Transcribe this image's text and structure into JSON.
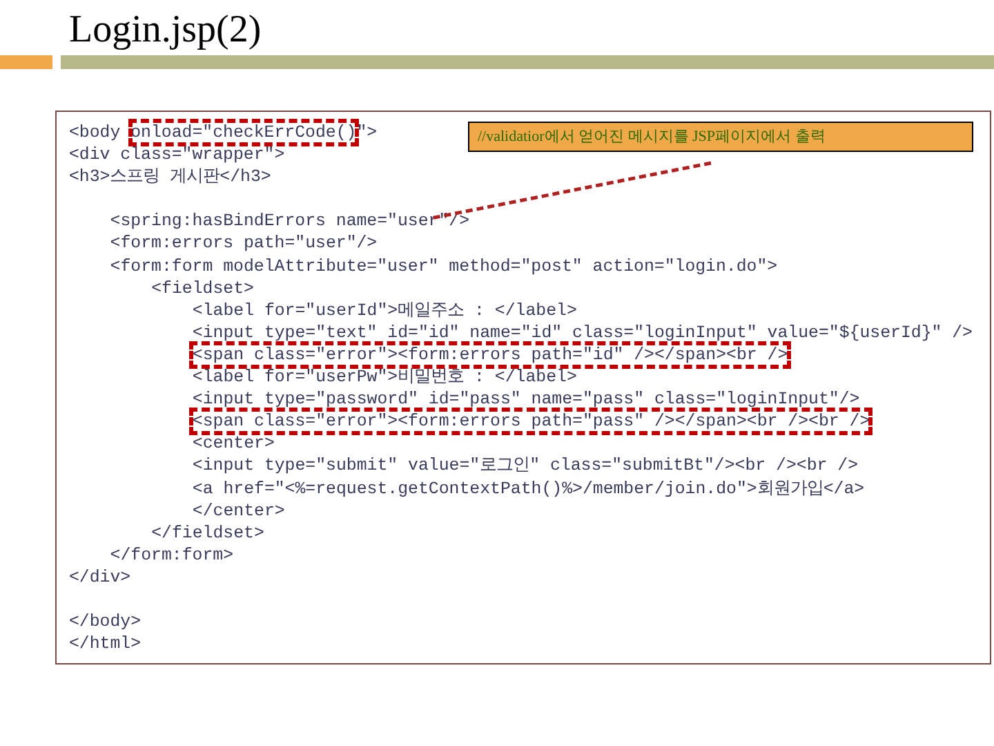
{
  "slide": {
    "title": "Login.jsp(2)"
  },
  "code": {
    "lines": [
      {
        "kind": "code",
        "segments": [
          {
            "text": "<body ",
            "highlighted": false
          },
          {
            "text": "onload=\"checkErrCode()",
            "highlighted": true
          },
          {
            "text": "\">",
            "highlighted": false
          }
        ]
      },
      {
        "kind": "code",
        "segments": [
          {
            "text": "<div class=\"wrapper\">",
            "highlighted": false
          }
        ]
      },
      {
        "kind": "code",
        "segments": [
          {
            "text": "<h3>스프링 게시판</h3>",
            "highlighted": false
          }
        ]
      },
      {
        "kind": "blank"
      },
      {
        "kind": "group",
        "children": [
          {
            "kind": "code",
            "segments": [
              {
                "text": "<spring:hasBindErrors name=\"user\"/>",
                "highlighted": false
              }
            ]
          },
          {
            "kind": "code",
            "segments": [
              {
                "text": "<form:errors path=\"user\"/>",
                "highlighted": false
              }
            ]
          },
          {
            "kind": "code",
            "segments": [
              {
                "text": "<form:form modelAttribute=\"user\" method=\"post\" action=\"login.do\">",
                "highlighted": false
              }
            ]
          },
          {
            "kind": "group",
            "children": [
              {
                "kind": "code",
                "segments": [
                  {
                    "text": "<fieldset>",
                    "highlighted": false
                  }
                ]
              },
              {
                "kind": "group",
                "children": [
                  {
                    "kind": "code",
                    "segments": [
                      {
                        "text": "<label for=\"userId\">메일주소 : </label>",
                        "highlighted": false
                      }
                    ]
                  },
                  {
                    "kind": "code",
                    "segments": [
                      {
                        "text": "<input type=\"text\" id=\"id\" name=\"id\" class=\"loginInput\" value=\"${userId}\" />",
                        "highlighted": false
                      }
                    ]
                  },
                  {
                    "kind": "code",
                    "segments": [
                      {
                        "text": "<span class=\"error\"><form:errors path=\"id\" /></span><br />",
                        "highlighted": true
                      }
                    ]
                  },
                  {
                    "kind": "code",
                    "segments": [
                      {
                        "text": "<label for=\"userPw\">비밀번호 : </label>",
                        "highlighted": false
                      }
                    ]
                  },
                  {
                    "kind": "code",
                    "segments": [
                      {
                        "text": "<input type=\"password\" id=\"pass\" name=\"pass\" class=\"loginInput\"/>",
                        "highlighted": false
                      }
                    ]
                  },
                  {
                    "kind": "code",
                    "segments": [
                      {
                        "text": "<span class=\"error\"><form:errors path=\"pass\" /></span><br /><br />",
                        "highlighted": true
                      }
                    ]
                  },
                  {
                    "kind": "code",
                    "segments": [
                      {
                        "text": "<center>",
                        "highlighted": false
                      }
                    ]
                  },
                  {
                    "kind": "code",
                    "segments": [
                      {
                        "text": "<input type=\"submit\" value=\"로그인\" class=\"submitBt\"/><br /><br />",
                        "highlighted": false
                      }
                    ]
                  },
                  {
                    "kind": "code",
                    "segments": [
                      {
                        "text": "<a href=\"<%=request.getContextPath()%>/member/join.do\">회원가입</a>",
                        "highlighted": false
                      }
                    ]
                  },
                  {
                    "kind": "code",
                    "segments": [
                      {
                        "text": "</center>",
                        "highlighted": false
                      }
                    ]
                  }
                ]
              },
              {
                "kind": "code",
                "segments": [
                  {
                    "text": "</fieldset>",
                    "highlighted": false
                  }
                ]
              }
            ]
          },
          {
            "kind": "code",
            "segments": [
              {
                "text": "</form:form>",
                "highlighted": false
              }
            ]
          }
        ]
      },
      {
        "kind": "code",
        "segments": [
          {
            "text": "</div>",
            "highlighted": false
          }
        ]
      },
      {
        "kind": "blank"
      },
      {
        "kind": "code",
        "segments": [
          {
            "text": "</body>",
            "highlighted": false
          }
        ]
      },
      {
        "kind": "code",
        "segments": [
          {
            "text": "</html>",
            "highlighted": false
          }
        ]
      }
    ]
  },
  "callout": {
    "text": "//validatior에서 얻어진 메시지를 JSP페이지에서 출력"
  }
}
